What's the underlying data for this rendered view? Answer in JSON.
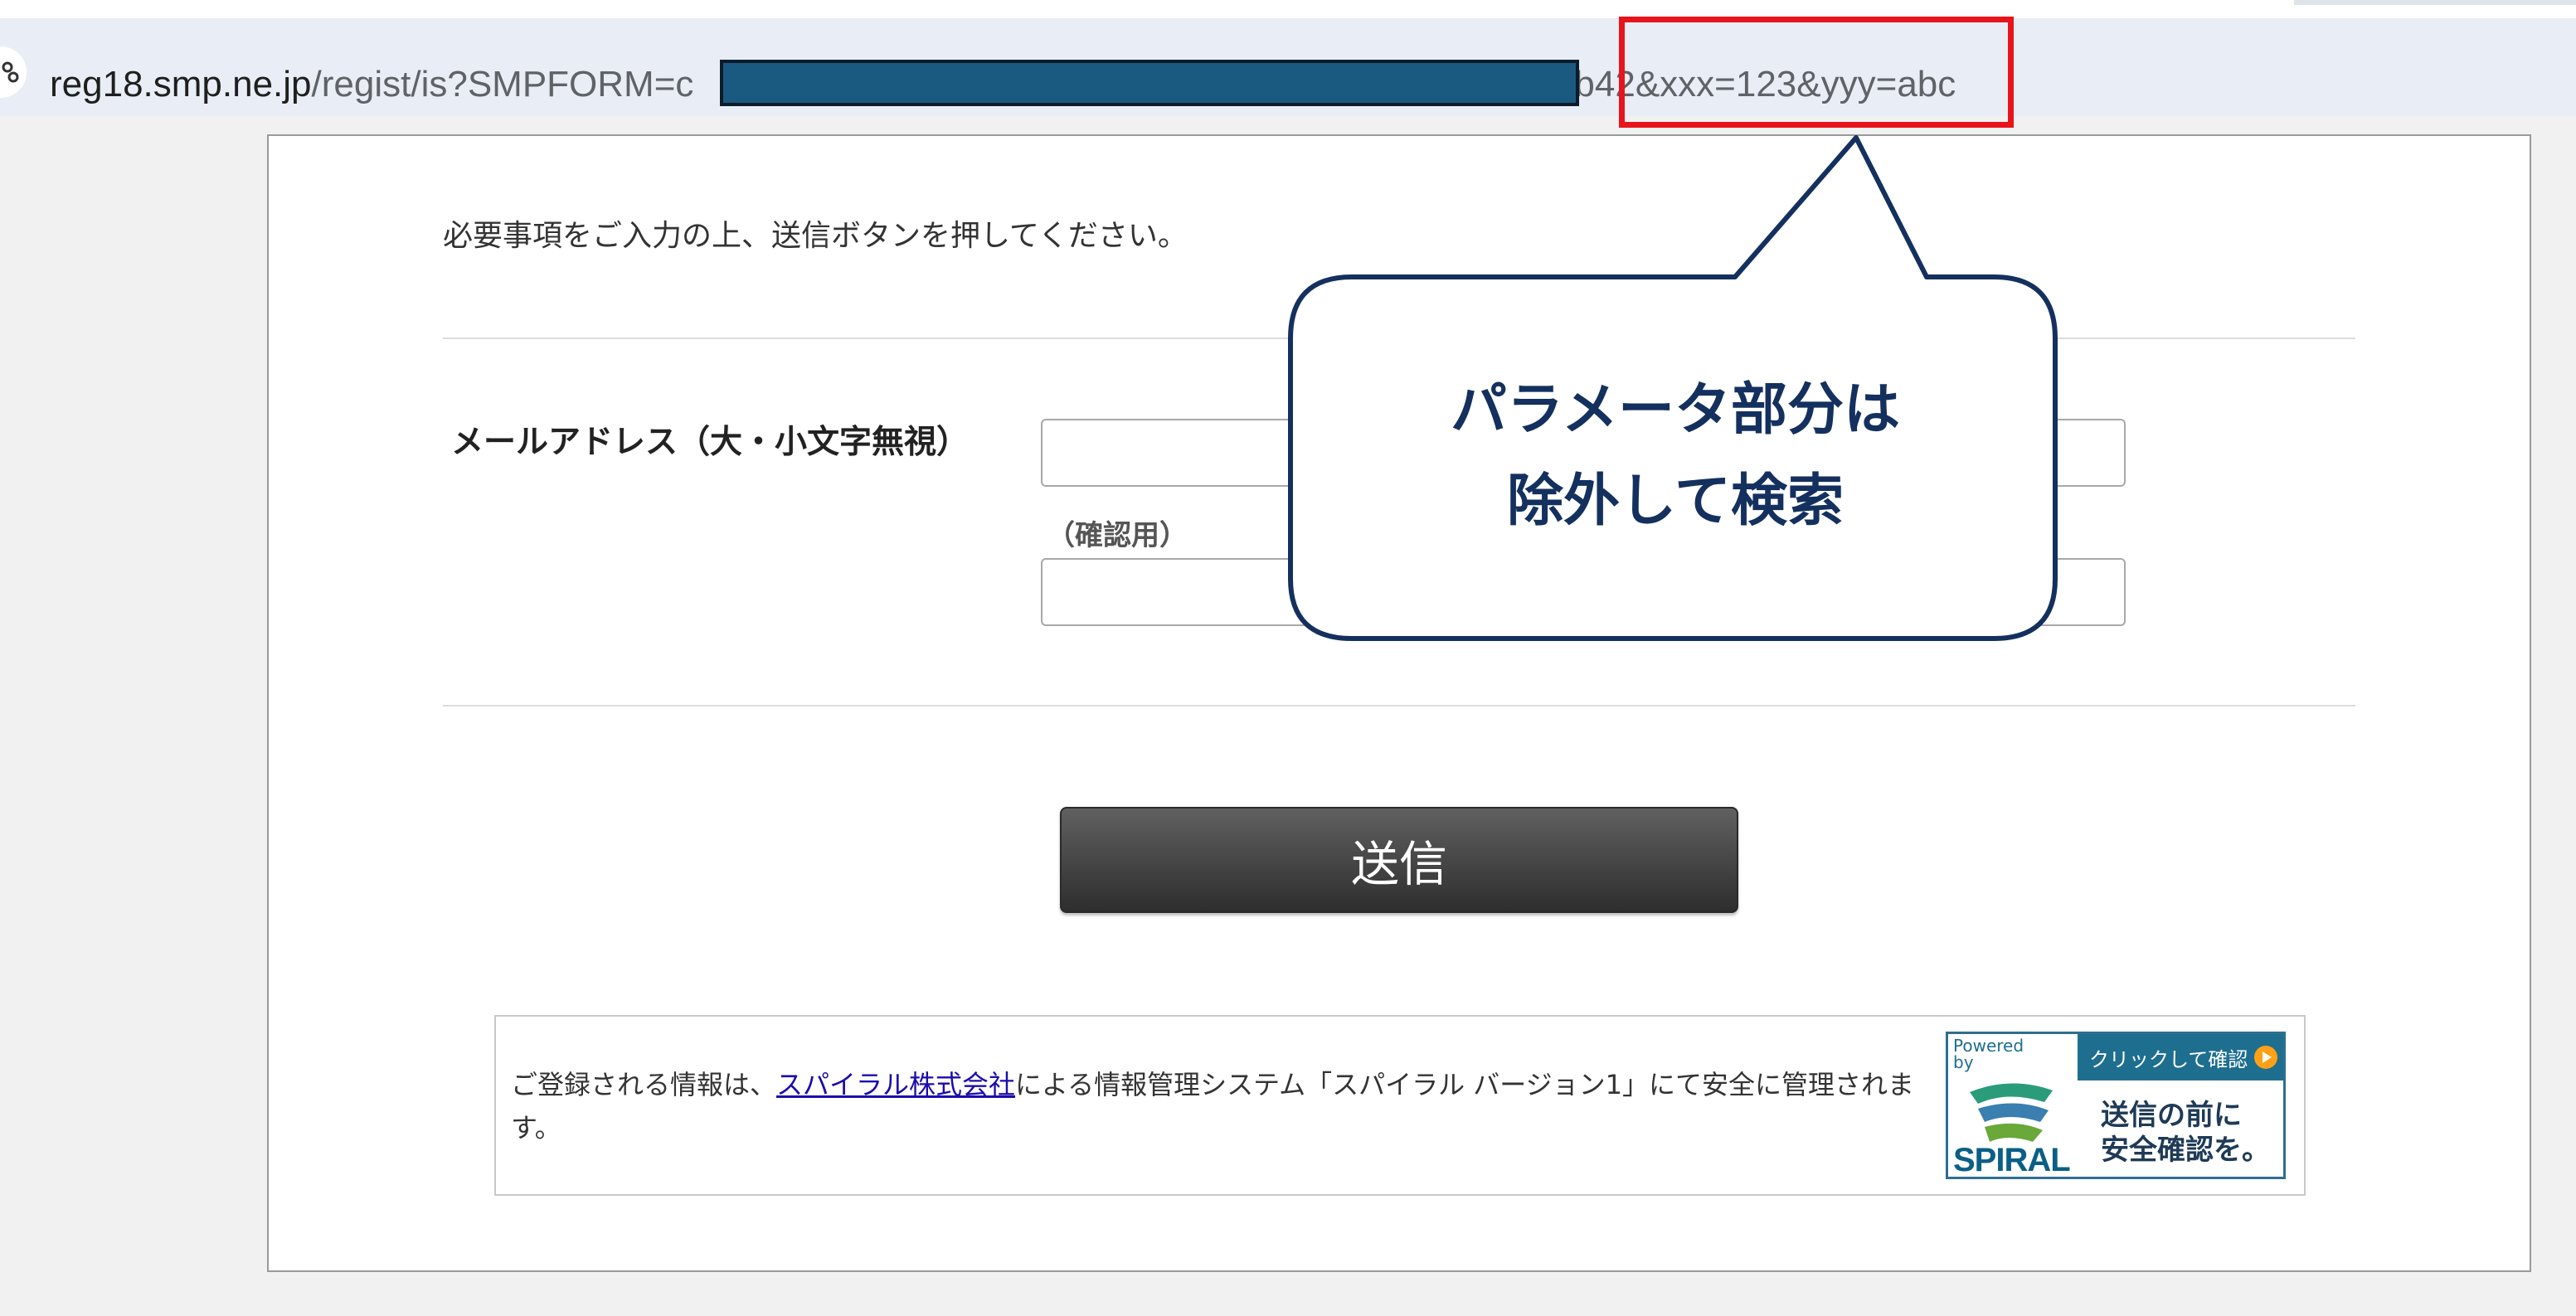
{
  "browser": {
    "url_host": "reg18.smp.ne.jp",
    "url_path_prefix": "/regist/is?SMPFORM=c",
    "url_path_visible_suffix": "b42&xxx=123&yyy=abc"
  },
  "form": {
    "instruction": "必要事項をご入力の上、送信ボタンを押してください。",
    "email_label": "メールアドレス（大・小文字無視）",
    "email_value": "",
    "confirm_label": "（確認用）",
    "confirm_value": "",
    "submit_label": "送信"
  },
  "footer": {
    "text_before_link": "ご登録される情報は、",
    "link_text": "スパイラル株式会社",
    "text_after_link": "による情報管理システム「スパイラル バージョン1」にて安全に管理されます。",
    "badge": {
      "powered_by": "Powered by",
      "click_label": "クリックして確認",
      "line1": "送信の前に",
      "line2": "安全確認を。",
      "wordmark": "SPIRAL"
    }
  },
  "annotation": {
    "line1": "パラメータ部分は",
    "line2": "除外して検索",
    "border_color": "#14305e",
    "highlight_color": "#e8141c"
  }
}
